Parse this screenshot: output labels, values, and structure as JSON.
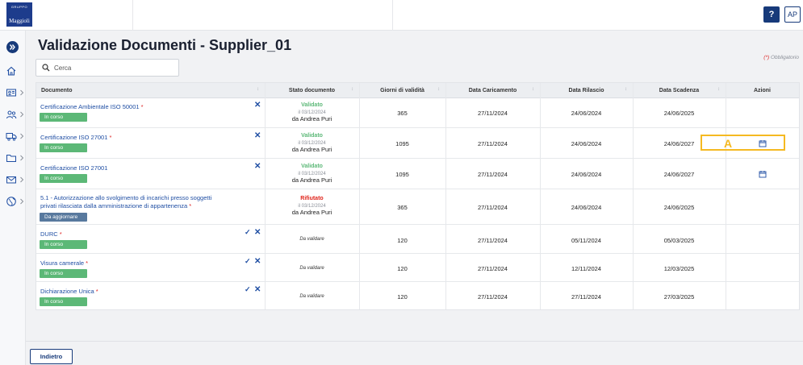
{
  "header": {
    "logo_top": "GRUPPO",
    "logo_bottom": "Maggioli",
    "help_label": "?",
    "user_initials": "AP"
  },
  "sidebar": {
    "items": [
      {
        "icon": "home-icon"
      },
      {
        "icon": "id-card-icon"
      },
      {
        "icon": "users-icon"
      },
      {
        "icon": "truck-icon"
      },
      {
        "icon": "folder-icon"
      },
      {
        "icon": "mail-icon"
      },
      {
        "icon": "globe-icon"
      }
    ]
  },
  "page": {
    "title": "Validazione Documenti - Supplier_01",
    "required_note": "(*) Obbligatorio",
    "required_mark": "(*)",
    "required_text": " Obbligatorio",
    "search_placeholder": "Cerca"
  },
  "table": {
    "columns": [
      "Documento",
      "Stato documento",
      "Giorni di validità",
      "Data Caricamento",
      "Data Rilascio",
      "Data Scadenza",
      "Azioni"
    ],
    "rows": [
      {
        "name": "Certificazione Ambientale ISO 50001",
        "required": "*",
        "badge": "In corso",
        "status": "Validato",
        "status_date": "il 03/12/2024",
        "status_by": "da Andrea Puri",
        "days": "365",
        "uploaded": "27/11/2024",
        "issued": "24/06/2024",
        "expiry": "24/06/2025"
      },
      {
        "name": "Certificazione ISO 27001",
        "required": "*",
        "badge": "In corso",
        "status": "Validato",
        "status_date": "il 03/12/2024",
        "status_by": "da Andrea Puri",
        "days": "1095",
        "uploaded": "27/11/2024",
        "issued": "24/06/2024",
        "expiry": "24/06/2027"
      },
      {
        "name": "Certificazione ISO 27001",
        "required": "",
        "badge": "In corso",
        "status": "Validato",
        "status_date": "il 03/12/2024",
        "status_by": "da Andrea Puri",
        "days": "1095",
        "uploaded": "27/11/2024",
        "issued": "24/06/2024",
        "expiry": "24/06/2027"
      },
      {
        "name_line1": "5.1 - Autorizzazione allo svolgimento di incarichi presso soggetti",
        "name_line2": "privati rilasciata dalla amministrazione di appartenenza",
        "required": "*",
        "badge": "Da aggiornare",
        "status": "Rifiutato",
        "status_date": "il 03/12/2024",
        "status_by": "da Andrea Puri",
        "days": "365",
        "uploaded": "27/11/2024",
        "issued": "24/06/2024",
        "expiry": "24/06/2025"
      },
      {
        "name": "DURC",
        "required": "*",
        "badge": "In corso",
        "status": "Da validare",
        "days": "120",
        "uploaded": "27/11/2024",
        "issued": "05/11/2024",
        "expiry": "05/03/2025"
      },
      {
        "name": "Visura camerale",
        "required": "*",
        "badge": "In corso",
        "status": "Da validare",
        "days": "120",
        "uploaded": "27/11/2024",
        "issued": "12/11/2024",
        "expiry": "12/03/2025"
      },
      {
        "name": "Dichiarazione Unica",
        "required": "*",
        "badge": "In corso",
        "status": "Da validare",
        "days": "120",
        "uploaded": "27/11/2024",
        "issued": "27/11/2024",
        "expiry": "27/03/2025"
      }
    ],
    "check_glyph": "✓",
    "reject_glyph": "✕",
    "sort_glyph": "↕"
  },
  "annotation": {
    "label": "A",
    "color": "#f5b921"
  },
  "footer": {
    "back_label": "Indietro"
  },
  "colors": {
    "primary": "#173a7a",
    "link": "#1f4ea3",
    "success": "#5cb877",
    "danger": "#e0241b",
    "badge_update": "#58799e"
  }
}
